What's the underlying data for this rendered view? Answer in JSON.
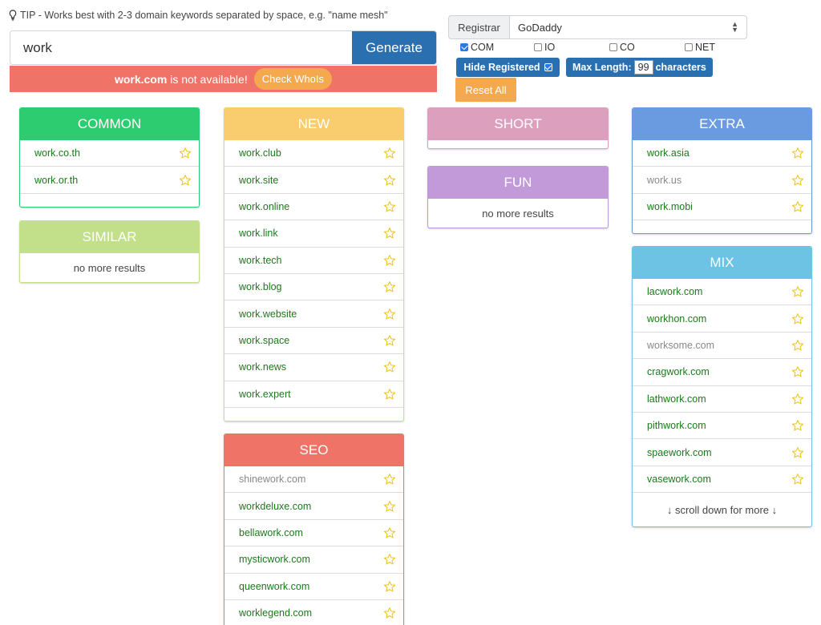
{
  "tip": "TIP - Works best with 2-3 domain keywords separated by space, e.g. \"name mesh\"",
  "search": {
    "value": "work",
    "generate_label": "Generate"
  },
  "alert": {
    "domain": "work.com",
    "message": "is not available!",
    "whois_label": "Check WhoIs"
  },
  "registrar": {
    "label": "Registrar",
    "selected": "GoDaddy"
  },
  "tlds": [
    {
      "label": "COM",
      "checked": true
    },
    {
      "label": "IO",
      "checked": false
    },
    {
      "label": "CO",
      "checked": false
    },
    {
      "label": "NET",
      "checked": false
    }
  ],
  "hide_registered": {
    "label": "Hide Registered",
    "checked": true
  },
  "max_length": {
    "label": "Max Length:",
    "value": "99",
    "suffix": "characters"
  },
  "reset_label": "Reset All",
  "no_more": "no more results",
  "scroll_more": "↓ scroll down for more ↓",
  "colors": {
    "common": "#2ecc71",
    "new": "#f9cd6d",
    "short": "#dca0be",
    "extra": "#6a9be0",
    "similar": "#c2e08a",
    "fun": "#c39ad9",
    "seo": "#ef7467",
    "mix": "#6cc3e4",
    "available": "#1a7a1a",
    "registered": "#888888",
    "accent": "#2a6fb0"
  },
  "panels": {
    "common": {
      "title": "COMMON",
      "items": [
        {
          "name": "work.co.th",
          "registered": false
        },
        {
          "name": "work.or.th",
          "registered": false
        }
      ]
    },
    "similar": {
      "title": "SIMILAR",
      "items": []
    },
    "new": {
      "title": "NEW",
      "items": [
        {
          "name": "work.club",
          "registered": false
        },
        {
          "name": "work.site",
          "registered": false
        },
        {
          "name": "work.online",
          "registered": false
        },
        {
          "name": "work.link",
          "registered": false
        },
        {
          "name": "work.tech",
          "registered": false
        },
        {
          "name": "work.blog",
          "registered": false
        },
        {
          "name": "work.website",
          "registered": false
        },
        {
          "name": "work.space",
          "registered": false
        },
        {
          "name": "work.news",
          "registered": false
        },
        {
          "name": "work.expert",
          "registered": false
        }
      ]
    },
    "seo": {
      "title": "SEO",
      "items": [
        {
          "name": "shinework.com",
          "registered": true
        },
        {
          "name": "workdeluxe.com",
          "registered": false
        },
        {
          "name": "bellawork.com",
          "registered": false
        },
        {
          "name": "mysticwork.com",
          "registered": false
        },
        {
          "name": "queenwork.com",
          "registered": false
        },
        {
          "name": "worklegend.com",
          "registered": false
        }
      ]
    },
    "short": {
      "title": "SHORT",
      "items": []
    },
    "fun": {
      "title": "FUN",
      "items": []
    },
    "extra": {
      "title": "EXTRA",
      "items": [
        {
          "name": "work.asia",
          "registered": false
        },
        {
          "name": "work.us",
          "registered": true
        },
        {
          "name": "work.mobi",
          "registered": false
        }
      ]
    },
    "mix": {
      "title": "MIX",
      "items": [
        {
          "name": "lacwork.com",
          "registered": false
        },
        {
          "name": "workhon.com",
          "registered": false
        },
        {
          "name": "worksome.com",
          "registered": true
        },
        {
          "name": "cragwork.com",
          "registered": false
        },
        {
          "name": "lathwork.com",
          "registered": false
        },
        {
          "name": "pithwork.com",
          "registered": false
        },
        {
          "name": "spaework.com",
          "registered": false
        },
        {
          "name": "vasework.com",
          "registered": false
        }
      ]
    }
  }
}
